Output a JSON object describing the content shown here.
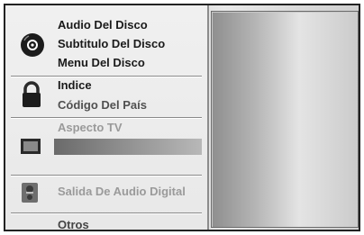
{
  "menu": {
    "disc_group": {
      "icon": "disc-icon",
      "items": [
        "Audio Del Disco",
        "Subtitulo Del Disco",
        "Menu Del Disco"
      ]
    },
    "lock_group": {
      "icon": "lock-icon",
      "items": [
        "Indice",
        "Código Del País"
      ]
    },
    "tv_group": {
      "icon": "tv-screen-icon",
      "items": [
        "Aspecto TV"
      ]
    },
    "audio_group": {
      "icon": "speaker-icon",
      "items": [
        "Salida De Audio Digital"
      ]
    },
    "others_label": "Otros"
  }
}
